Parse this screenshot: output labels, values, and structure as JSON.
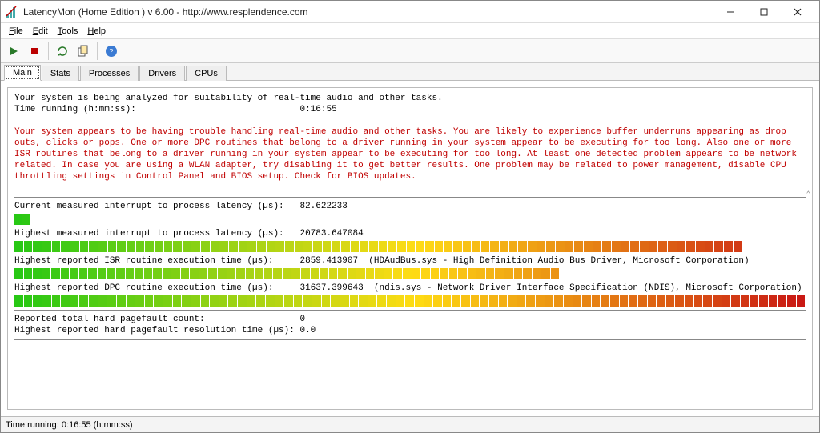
{
  "window": {
    "title": "LatencyMon  (Home Edition )  v 6.00 - http://www.resplendence.com"
  },
  "menu": {
    "file": "File",
    "edit": "Edit",
    "tools": "Tools",
    "help": "Help"
  },
  "tabs": {
    "main": "Main",
    "stats": "Stats",
    "processes": "Processes",
    "drivers": "Drivers",
    "cpus": "CPUs"
  },
  "report": {
    "analyzing_line": "Your system is being analyzed for suitability of real-time audio and other tasks.",
    "time_running_label": "Time running (h:mm:ss):",
    "time_running_value": "0:16:55",
    "warning_text": "Your system appears to be having trouble handling real-time audio and other tasks. You are likely to experience buffer underruns appearing as drop outs, clicks or pops. One or more DPC routines that belong to a driver running in your system appear to be executing for too long. Also one or more ISR routines that belong to a driver running in your system appear to be executing for too long. At least one detected problem appears to be network related. In case you are using a WLAN adapter, try disabling it to get better results. One problem may be related to power management, disable CPU throttling settings in Control Panel and BIOS setup. Check for BIOS updates."
  },
  "metrics": {
    "current_int_label": "Current measured interrupt to process latency (µs):",
    "current_int_value": "82.622233",
    "current_int_fill_pct": 2,
    "highest_int_label": "Highest measured interrupt to process latency (µs):",
    "highest_int_value": "20783.647084",
    "highest_int_fill_pct": 92,
    "isr_label": "Highest reported ISR routine execution time (µs):",
    "isr_value": "2859.413907",
    "isr_detail": "(HDAudBus.sys - High Definition Audio Bus Driver, Microsoft Corporation)",
    "isr_fill_pct": 69,
    "dpc_label": "Highest reported DPC routine execution time (µs):",
    "dpc_value": "31637.399643",
    "dpc_detail": "(ndis.sys - Network Driver Interface Specification (NDIS), Microsoft Corporation)",
    "dpc_fill_pct": 100,
    "pagefault_count_label": "Reported total hard pagefault count:",
    "pagefault_count_value": "0",
    "pagefault_time_label": "Highest reported hard pagefault resolution time (µs):",
    "pagefault_time_value": "0.0"
  },
  "statusbar": {
    "text": "Time running: 0:16:55  (h:mm:ss)"
  },
  "chart_data": {
    "type": "bar",
    "title": "LatencyMon latency gauges",
    "xlabel": "",
    "ylabel": "µs",
    "series": [
      {
        "name": "Current measured interrupt to process latency (µs)",
        "value": 82.622233,
        "fill_pct": 2
      },
      {
        "name": "Highest measured interrupt to process latency (µs)",
        "value": 20783.647084,
        "fill_pct": 92
      },
      {
        "name": "Highest reported ISR routine execution time (µs)",
        "value": 2859.413907,
        "fill_pct": 69,
        "detail": "HDAudBus.sys - High Definition Audio Bus Driver, Microsoft Corporation"
      },
      {
        "name": "Highest reported DPC routine execution time (µs)",
        "value": 31637.399643,
        "fill_pct": 100,
        "detail": "ndis.sys - Network Driver Interface Specification (NDIS), Microsoft Corporation"
      }
    ],
    "gradient": "green→yellow→orange→red"
  }
}
